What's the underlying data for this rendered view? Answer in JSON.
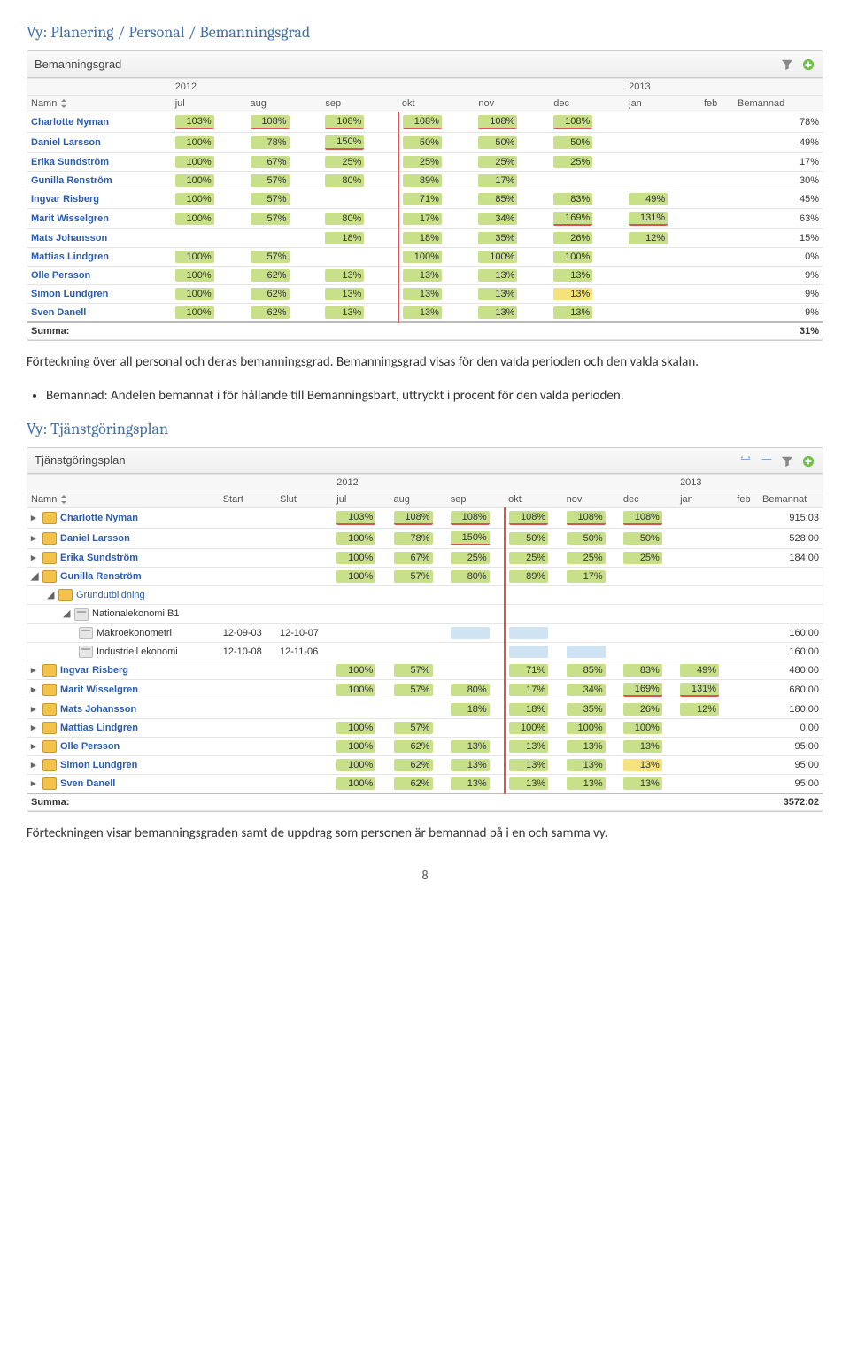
{
  "heading1": "Vy: Planering / Personal / Bemanningsgrad",
  "panel1": {
    "title": "Bemanningsgrad"
  },
  "years": {
    "y1": "2012",
    "y2": "2013"
  },
  "cols1": {
    "name": "Namn",
    "jul": "jul",
    "aug": "aug",
    "sep": "sep",
    "okt": "okt",
    "nov": "nov",
    "dec": "dec",
    "jan": "jan",
    "feb": "feb",
    "last": "Bemannad"
  },
  "t1": {
    "r0": {
      "n": "Charlotte Nyman",
      "jul": "103%",
      "aug": "108%",
      "sep": "108%",
      "okt": "108%",
      "nov": "108%",
      "dec": "108%",
      "jan": "",
      "feb": "",
      "b": "78%"
    },
    "r1": {
      "n": "Daniel Larsson",
      "jul": "100%",
      "aug": "78%",
      "sep": "150%",
      "okt": "50%",
      "nov": "50%",
      "dec": "50%",
      "jan": "",
      "feb": "",
      "b": "49%"
    },
    "r2": {
      "n": "Erika Sundström",
      "jul": "100%",
      "aug": "67%",
      "sep": "25%",
      "okt": "25%",
      "nov": "25%",
      "dec": "25%",
      "jan": "",
      "feb": "",
      "b": "17%"
    },
    "r3": {
      "n": "Gunilla Renström",
      "jul": "100%",
      "aug": "57%",
      "sep": "80%",
      "okt": "89%",
      "nov": "17%",
      "dec": "",
      "jan": "",
      "feb": "",
      "b": "30%"
    },
    "r4": {
      "n": "Ingvar Risberg",
      "jul": "100%",
      "aug": "57%",
      "sep": "",
      "okt": "71%",
      "nov": "85%",
      "dec": "83%",
      "jan": "49%",
      "feb": "",
      "b": "45%"
    },
    "r5": {
      "n": "Marit Wisselgren",
      "jul": "100%",
      "aug": "57%",
      "sep": "80%",
      "okt": "17%",
      "nov": "34%",
      "dec": "169%",
      "jan": "131%",
      "feb": "",
      "b": "63%"
    },
    "r6": {
      "n": "Mats Johansson",
      "jul": "",
      "aug": "",
      "sep": "18%",
      "okt": "18%",
      "nov": "35%",
      "dec": "26%",
      "jan": "12%",
      "feb": "",
      "b": "15%"
    },
    "r7": {
      "n": "Mattias Lindgren",
      "jul": "100%",
      "aug": "57%",
      "sep": "",
      "okt": "100%",
      "nov": "100%",
      "dec": "100%",
      "jan": "",
      "feb": "",
      "b": "0%"
    },
    "r8": {
      "n": "Olle Persson",
      "jul": "100%",
      "aug": "62%",
      "sep": "13%",
      "okt": "13%",
      "nov": "13%",
      "dec": "13%",
      "jan": "",
      "feb": "",
      "b": "9%"
    },
    "r9": {
      "n": "Simon Lundgren",
      "jul": "100%",
      "aug": "62%",
      "sep": "13%",
      "okt": "13%",
      "nov": "13%",
      "dec": "13%",
      "jan": "",
      "feb": "",
      "b": "9%"
    },
    "r10": {
      "n": "Sven Danell",
      "jul": "100%",
      "aug": "62%",
      "sep": "13%",
      "okt": "13%",
      "nov": "13%",
      "dec": "13%",
      "jan": "",
      "feb": "",
      "b": "9%"
    },
    "sum": {
      "label": "Summa:",
      "val": "31%"
    }
  },
  "para1a": "Förteckning över all personal och deras bemanningsgrad. Bemanningsgrad visas för den valda perioden och den valda skalan.",
  "bullet1": {
    "term": "Bemannad:",
    "rest": "  Andelen bemannat i för hållande till Bemanningsbart, uttryckt i procent för den valda perioden."
  },
  "heading2": "Vy: Tjänstgöringsplan",
  "panel2": {
    "title": "Tjänstgöringsplan"
  },
  "cols2": {
    "name": "Namn",
    "start": "Start",
    "slut": "Slut",
    "last": "Bemannat"
  },
  "t2": {
    "r0": {
      "n": "Charlotte Nyman",
      "jul": "103%",
      "aug": "108%",
      "sep": "108%",
      "okt": "108%",
      "nov": "108%",
      "dec": "108%",
      "b": "915:03"
    },
    "r1": {
      "n": "Daniel Larsson",
      "jul": "100%",
      "aug": "78%",
      "sep": "150%",
      "okt": "50%",
      "nov": "50%",
      "dec": "50%",
      "b": "528:00"
    },
    "r2": {
      "n": "Erika Sundström",
      "jul": "100%",
      "aug": "67%",
      "sep": "25%",
      "okt": "25%",
      "nov": "25%",
      "dec": "25%",
      "b": "184:00"
    },
    "r3": {
      "n": "Gunilla Renström",
      "jul": "100%",
      "aug": "57%",
      "sep": "80%",
      "okt": "89%",
      "nov": "17%"
    },
    "r3a": {
      "n": "Grundutbildning"
    },
    "r3b": {
      "n": "Nationalekonomi B1"
    },
    "r3c": {
      "n": "Makroekonometri",
      "start": "12-09-03",
      "slut": "12-10-07",
      "b": "160:00"
    },
    "r3d": {
      "n": "Industriell ekonomi",
      "start": "12-10-08",
      "slut": "12-11-06",
      "b": "160:00"
    },
    "r4": {
      "n": "Ingvar Risberg",
      "jul": "100%",
      "aug": "57%",
      "okt": "71%",
      "nov": "85%",
      "dec": "83%",
      "jan": "49%",
      "b": "480:00"
    },
    "r5": {
      "n": "Marit Wisselgren",
      "jul": "100%",
      "aug": "57%",
      "sep": "80%",
      "okt": "17%",
      "nov": "34%",
      "dec": "169%",
      "jan": "131%",
      "b": "680:00"
    },
    "r6": {
      "n": "Mats Johansson",
      "sep": "18%",
      "okt": "18%",
      "nov": "35%",
      "dec": "26%",
      "jan": "12%",
      "b": "180:00"
    },
    "r7": {
      "n": "Mattias Lindgren",
      "jul": "100%",
      "aug": "57%",
      "okt": "100%",
      "nov": "100%",
      "dec": "100%",
      "b": "0:00"
    },
    "r8": {
      "n": "Olle Persson",
      "jul": "100%",
      "aug": "62%",
      "sep": "13%",
      "okt": "13%",
      "nov": "13%",
      "dec": "13%",
      "b": "95:00"
    },
    "r9": {
      "n": "Simon Lundgren",
      "jul": "100%",
      "aug": "62%",
      "sep": "13%",
      "okt": "13%",
      "nov": "13%",
      "dec": "13%",
      "b": "95:00"
    },
    "r10": {
      "n": "Sven Danell",
      "jul": "100%",
      "aug": "62%",
      "sep": "13%",
      "okt": "13%",
      "nov": "13%",
      "dec": "13%",
      "b": "95:00"
    },
    "sum": {
      "label": "Summa:",
      "val": "3572:02"
    }
  },
  "para2": "Förteckningen visar bemanningsgraden samt de uppdrag som personen är bemannad på i en och samma vy.",
  "pagenum": "8"
}
